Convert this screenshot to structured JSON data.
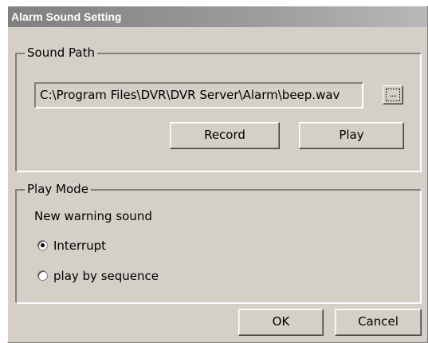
{
  "window": {
    "title": "Alarm Sound Setting"
  },
  "sound_path": {
    "group_label": "Sound Path",
    "path_value": "C:\\Program Files\\DVR\\DVR Server\\Alarm\\beep.wav",
    "browse_label": "....",
    "record_label": "Record",
    "play_label": "Play"
  },
  "play_mode": {
    "group_label": "Play Mode",
    "warning_label": "New warning sound",
    "options": [
      {
        "label": "Interrupt",
        "selected": true
      },
      {
        "label": "play by sequence",
        "selected": false
      }
    ]
  },
  "footer": {
    "ok_label": "OK",
    "cancel_label": "Cancel"
  }
}
